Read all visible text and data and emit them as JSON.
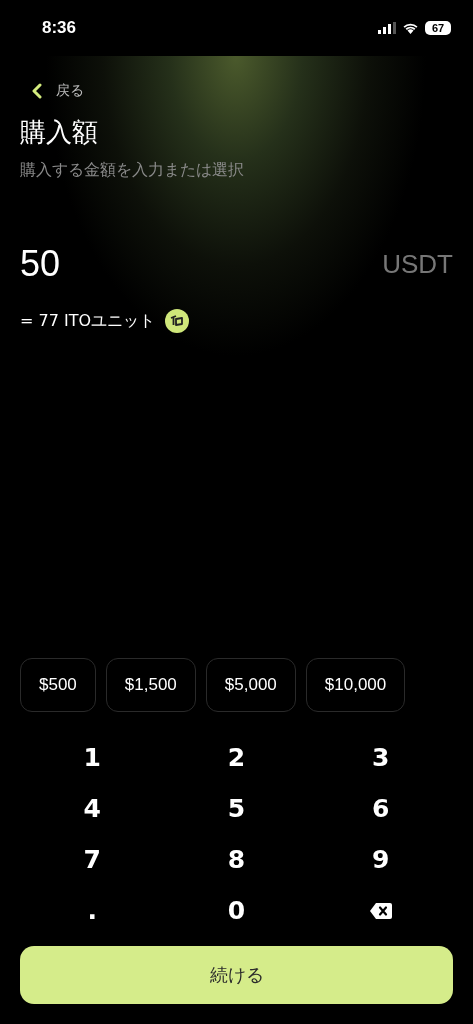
{
  "status_bar": {
    "time": "8:36",
    "battery": "67"
  },
  "header": {
    "back": "戻る",
    "title": "購入額",
    "subtitle": "購入する金額を入力または選択"
  },
  "amount": {
    "value": "50",
    "currency": "USDT",
    "conversion": "= 77 ITOユニット"
  },
  "presets": [
    "$500",
    "$1,500",
    "$5,000",
    "$10,000"
  ],
  "keypad": [
    {
      "kind": "digit",
      "label": "1"
    },
    {
      "kind": "digit",
      "label": "2"
    },
    {
      "kind": "digit",
      "label": "3"
    },
    {
      "kind": "digit",
      "label": "4"
    },
    {
      "kind": "digit",
      "label": "5"
    },
    {
      "kind": "digit",
      "label": "6"
    },
    {
      "kind": "digit",
      "label": "7"
    },
    {
      "kind": "digit",
      "label": "8"
    },
    {
      "kind": "digit",
      "label": "9"
    },
    {
      "kind": "digit",
      "label": "."
    },
    {
      "kind": "digit",
      "label": "0"
    },
    {
      "kind": "backspace"
    }
  ],
  "continue_button": "続ける"
}
